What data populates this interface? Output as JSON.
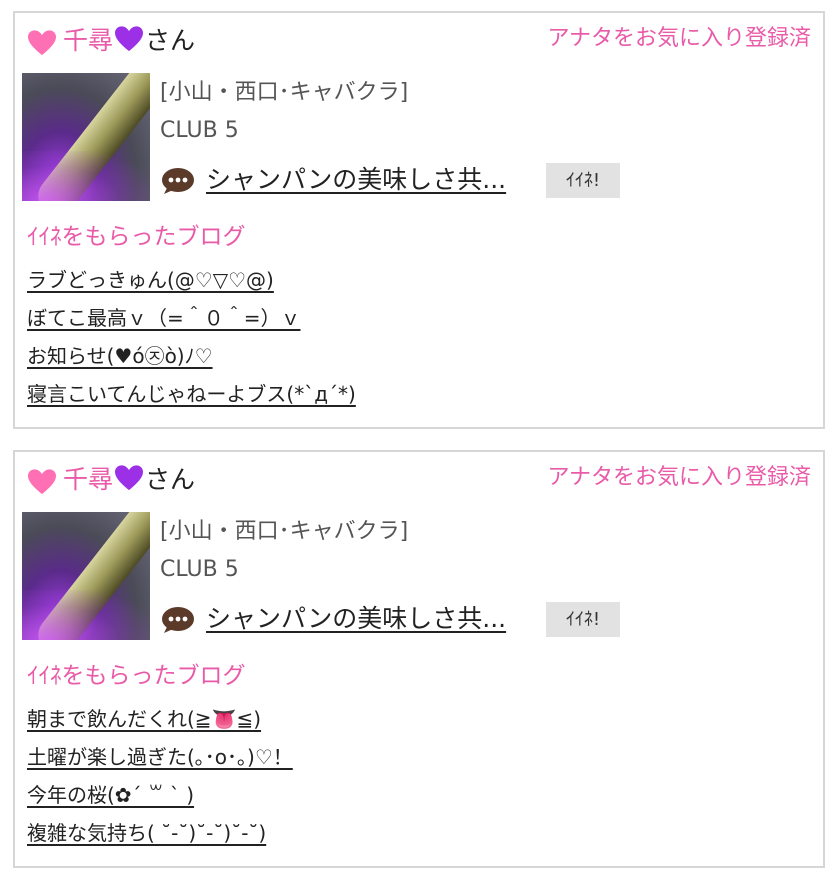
{
  "cards": [
    {
      "name_prefix": "千尋",
      "name_suffix": "さん",
      "favorite_status": "アナタをお気に入り登録済",
      "area": "[小山・西口･キャバクラ]",
      "club": "CLUB 5",
      "post_title": "シャンパンの美味しさ共...",
      "like_button": "ｲｲﾈ!",
      "liked_blogs_heading": "ｲｲﾈをもらったブログ",
      "blogs": [
        "ラブどっきゅん(@♡▽♡@)",
        "ぼてこ最高ｖ（=＾０＾=）ｖ",
        "お知らせ(♥ó㉨ò)ﾉ♡",
        "寝言こいてんじゃねーよブス(*`д´*)"
      ]
    },
    {
      "name_prefix": "千尋",
      "name_suffix": "さん",
      "favorite_status": "アナタをお気に入り登録済",
      "area": "[小山・西口･キャバクラ]",
      "club": "CLUB 5",
      "post_title": "シャンパンの美味しさ共...",
      "like_button": "ｲｲﾈ!",
      "liked_blogs_heading": "ｲｲﾈをもらったブログ",
      "blogs": [
        "朝まで飲んだくれ(≧👅≦)",
        "土曜が楽し過ぎた(｡･o･｡)♡！",
        "今年の桜(✿´ ꒳ ` )",
        "複雑な気持ち( ˘-˘)˘-˘)˘-˘)"
      ]
    }
  ],
  "colors": {
    "accent_pink": "#e95aa8",
    "heart_purple": "#9b30e6",
    "heart_pink": "#ff6fb3",
    "button_gray": "#e2e2e2"
  }
}
